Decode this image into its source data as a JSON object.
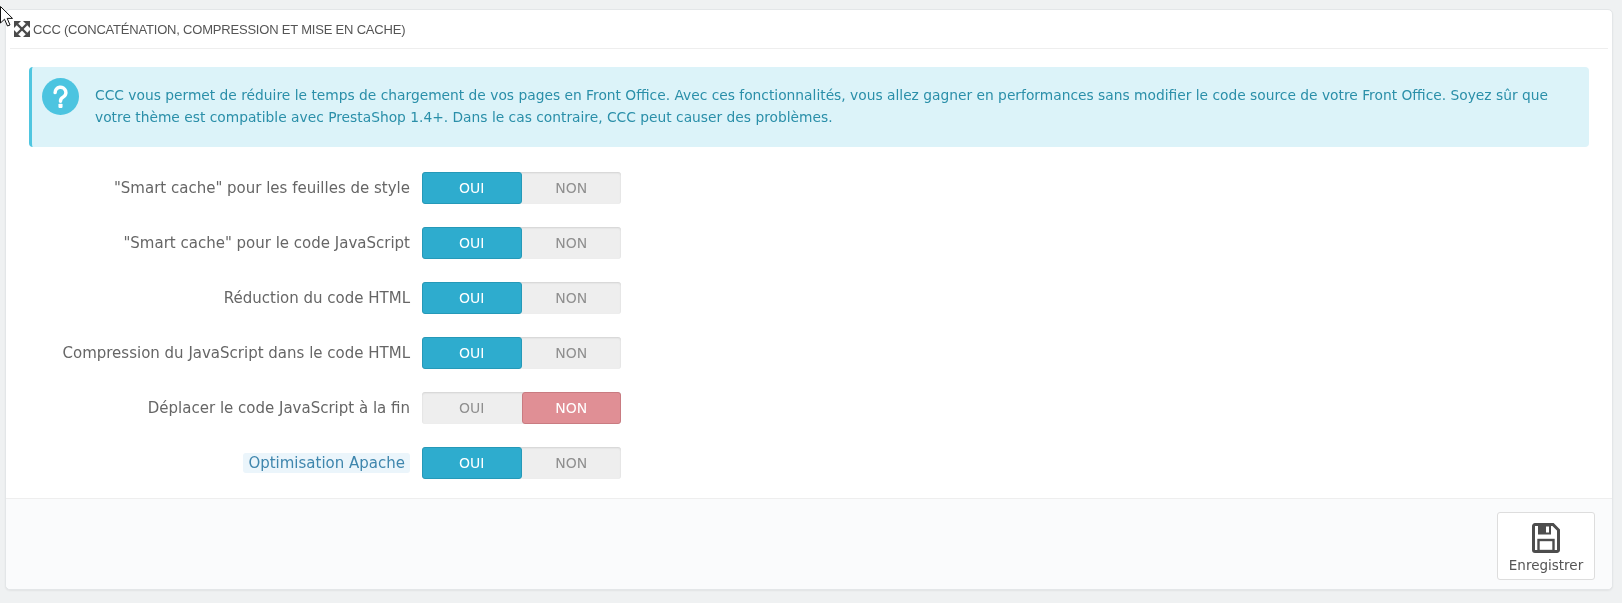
{
  "panel": {
    "title": "CCC (CONCATÉNATION, COMPRESSION ET MISE EN CACHE)"
  },
  "info": {
    "text": "CCC vous permet de réduire le temps de chargement de vos pages en Front Office. Avec ces fonctionnalités, vous allez gagner en performances sans modifier le code source de votre Front Office. Soyez sûr que votre thème est compatible avec PrestaShop 1.4+. Dans le cas contraire, CCC peut causer des problèmes."
  },
  "settings": [
    {
      "label": "\"Smart cache\" pour les feuilles de style",
      "kind": "plain",
      "options": [
        {
          "label": "OUI",
          "kind": "yes",
          "selected": true
        },
        {
          "label": "NON",
          "kind": "no",
          "selected": false
        }
      ]
    },
    {
      "label": "\"Smart cache\" pour le code JavaScript",
      "kind": "plain",
      "options": [
        {
          "label": "OUI",
          "kind": "yes",
          "selected": true
        },
        {
          "label": "NON",
          "kind": "no",
          "selected": false
        }
      ]
    },
    {
      "label": "Réduction du code HTML",
      "kind": "plain",
      "options": [
        {
          "label": "OUI",
          "kind": "yes",
          "selected": true
        },
        {
          "label": "NON",
          "kind": "no",
          "selected": false
        }
      ]
    },
    {
      "label": "Compression du JavaScript dans le code HTML",
      "kind": "plain",
      "options": [
        {
          "label": "OUI",
          "kind": "yes",
          "selected": true
        },
        {
          "label": "NON",
          "kind": "no",
          "selected": false
        }
      ]
    },
    {
      "label": "Déplacer le code JavaScript à la fin",
      "kind": "plain",
      "options": [
        {
          "label": "OUI",
          "kind": "yes",
          "selected": false
        },
        {
          "label": "NON",
          "kind": "no",
          "selected": true
        }
      ]
    },
    {
      "label": "Optimisation Apache",
      "kind": "hint",
      "options": [
        {
          "label": "OUI",
          "kind": "yes",
          "selected": true
        },
        {
          "label": "NON",
          "kind": "no",
          "selected": false
        }
      ]
    }
  ],
  "save_button": {
    "label": "Enregistrer"
  }
}
